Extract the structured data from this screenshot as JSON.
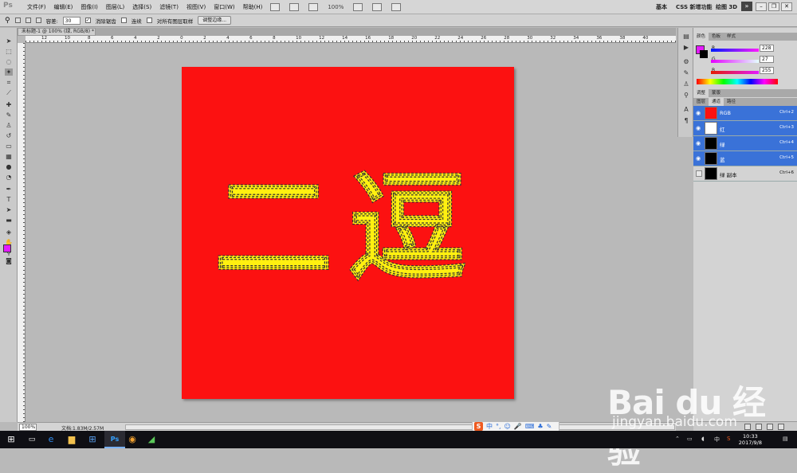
{
  "app": {
    "logo": "Ps",
    "menu": [
      "文件(F)",
      "编辑(E)",
      "图像(I)",
      "图层(L)",
      "选择(S)",
      "滤镜(T)",
      "视图(V)",
      "窗口(W)",
      "帮助(H)"
    ],
    "zoom_display": "100%",
    "workspaces": [
      "基本",
      "CSS 新增功能",
      "绘图 3D"
    ],
    "more_button": "»"
  },
  "options_bar": {
    "tolerance_label": "容差:",
    "tolerance_value": "30",
    "anti_alias_label": "消除锯齿",
    "anti_alias_checked": true,
    "contiguous_label": "连续",
    "contiguous_checked": false,
    "sample_all_label": "对所有图层取样",
    "sample_all_checked": false,
    "refine_edge_label": "调整边缘..."
  },
  "document": {
    "tab_title": "未标题-1 @ 100% (绿, RGB/8) *",
    "canvas_color": "#fc1111",
    "text": "二逗",
    "text_color": "#fff010"
  },
  "ruler": {
    "h_numbers": [
      "12",
      "10",
      "8",
      "6",
      "4",
      "2",
      "0",
      "2",
      "4",
      "6",
      "8",
      "10",
      "12",
      "14",
      "16",
      "18",
      "20",
      "22",
      "24",
      "26",
      "28",
      "30",
      "32",
      "34",
      "36",
      "38",
      "40"
    ]
  },
  "status": {
    "zoom": "100%",
    "doc_info": "文档:1.83M/2.57M"
  },
  "panels": {
    "color_tabs": [
      "颜色",
      "色板",
      "样式"
    ],
    "color": {
      "r_label": "R",
      "r_value": "228",
      "g_label": "G",
      "g_value": "27",
      "b_label": "B",
      "b_value": "255",
      "foreground": "#e41bff"
    },
    "adjust_tabs": [
      "调整",
      "蒙版"
    ],
    "layer_tabs": [
      "图层",
      "通道",
      "路径"
    ],
    "channels": [
      {
        "name": "RGB",
        "shortcut": "Ctrl+2",
        "selected": true,
        "visible": true
      },
      {
        "name": "红",
        "shortcut": "Ctrl+3",
        "selected": true,
        "visible": true
      },
      {
        "name": "绿",
        "shortcut": "Ctrl+4",
        "selected": true,
        "visible": true
      },
      {
        "name": "蓝",
        "shortcut": "Ctrl+5",
        "selected": true,
        "visible": true
      },
      {
        "name": "绿 副本",
        "shortcut": "Ctrl+6",
        "selected": false,
        "visible": false
      }
    ]
  },
  "taskbar": {
    "time": "10:33",
    "date": "2017/9/8"
  },
  "watermark": {
    "logo": "Bai du 经验",
    "url": "jingyan.baidu.com"
  }
}
